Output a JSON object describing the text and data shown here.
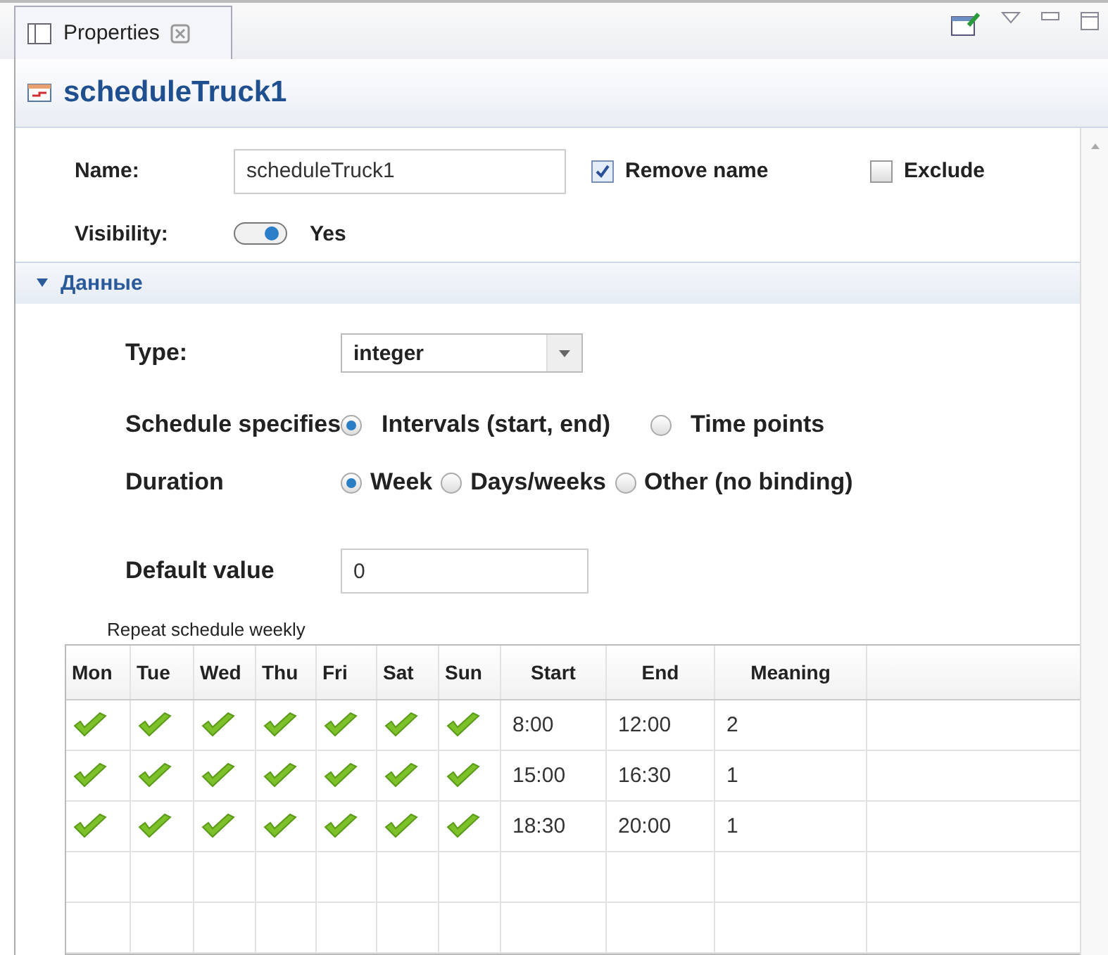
{
  "tab": {
    "label": "Properties",
    "selected": true
  },
  "header": {
    "title": "scheduleTruck1"
  },
  "name_field": {
    "label": "Name:",
    "value": "scheduleTruck1"
  },
  "remove_name": {
    "label": "Remove name",
    "checked": true
  },
  "exclude": {
    "label": "Exclude",
    "checked": false
  },
  "visibility": {
    "label": "Visibility:",
    "on": true,
    "text": "Yes"
  },
  "section": {
    "title": "Данные",
    "expanded": true
  },
  "type": {
    "label": "Type:",
    "value": "integer"
  },
  "schedule_specifies": {
    "label": "Schedule specifies",
    "options": [
      {
        "label": "Intervals (start, end)",
        "selected": true
      },
      {
        "label": "Time points",
        "selected": false
      }
    ]
  },
  "duration": {
    "label": "Duration",
    "options": [
      {
        "label": "Week",
        "selected": true
      },
      {
        "label": "Days/weeks",
        "selected": false
      },
      {
        "label": "Other (no binding)",
        "selected": false
      }
    ]
  },
  "default_value": {
    "label": "Default value",
    "value": "0"
  },
  "table": {
    "caption": "Repeat schedule weekly",
    "columns": [
      "Mon",
      "Tue",
      "Wed",
      "Thu",
      "Fri",
      "Sat",
      "Sun",
      "Start",
      "End",
      "Meaning"
    ],
    "rows": [
      {
        "days": [
          true,
          true,
          true,
          true,
          true,
          true,
          true
        ],
        "start": "8:00",
        "end": "12:00",
        "meaning": "2"
      },
      {
        "days": [
          true,
          true,
          true,
          true,
          true,
          true,
          true
        ],
        "start": "15:00",
        "end": "16:30",
        "meaning": "1"
      },
      {
        "days": [
          true,
          true,
          true,
          true,
          true,
          true,
          true
        ],
        "start": "18:30",
        "end": "20:00",
        "meaning": "1"
      }
    ]
  }
}
